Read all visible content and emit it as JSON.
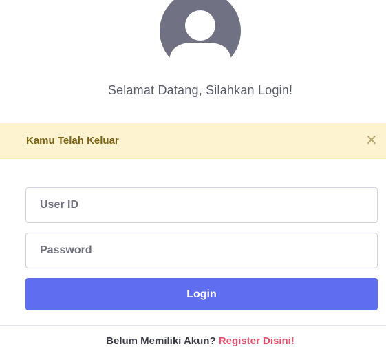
{
  "avatar": {
    "icon": "user-avatar-icon",
    "color": "#717184"
  },
  "heading": {
    "welcome": "Selamat Datang, Silahkan Login!"
  },
  "alert": {
    "message": "Kamu Telah Keluar",
    "close_symbol": "×",
    "background": "#fdf3d0",
    "text_color": "#7c6212"
  },
  "form": {
    "user_id_placeholder": "User ID",
    "password_placeholder": "Password",
    "login_label": "Login",
    "button_color": "#5f6df0"
  },
  "footer": {
    "prompt": "Belum Memiliki Akun? ",
    "register_link": "Register Disini!",
    "link_color": "#e74a6b"
  }
}
